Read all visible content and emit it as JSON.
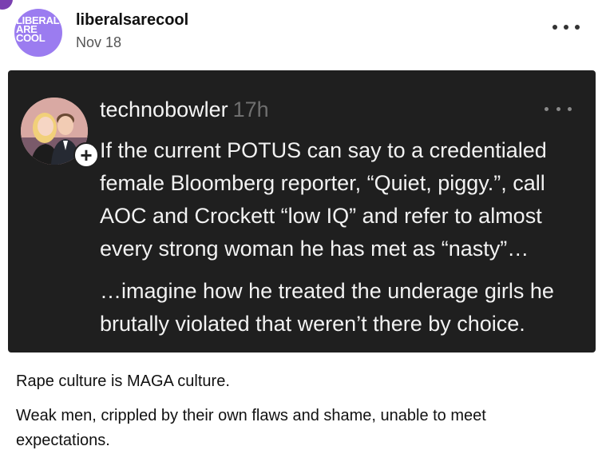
{
  "post": {
    "author": "liberalsarecool",
    "date": "Nov 18",
    "avatar_logo_text": "LIBERALS\nARE\nCOOL",
    "avatar_color": "#9b7cf0",
    "more_icon": "ellipsis-icon"
  },
  "embed": {
    "author": "technobowler",
    "time": "17h",
    "background": "#1f1f1f",
    "follow_icon": "plus-icon",
    "paragraphs": [
      "If the current POTUS can say to a credentialed female Bloomberg reporter, “Quiet, piggy.”, call AOC and Crockett “low IQ” and refer to almost every strong woman he has met as “nasty”…",
      "…imagine how he treated the underage girls he brutally violated that weren’t there by choice."
    ]
  },
  "caption": {
    "paragraphs": [
      "Rape culture is MAGA culture.",
      "Weak men, crippled by their own flaws and shame, unable to meet expectations."
    ]
  }
}
